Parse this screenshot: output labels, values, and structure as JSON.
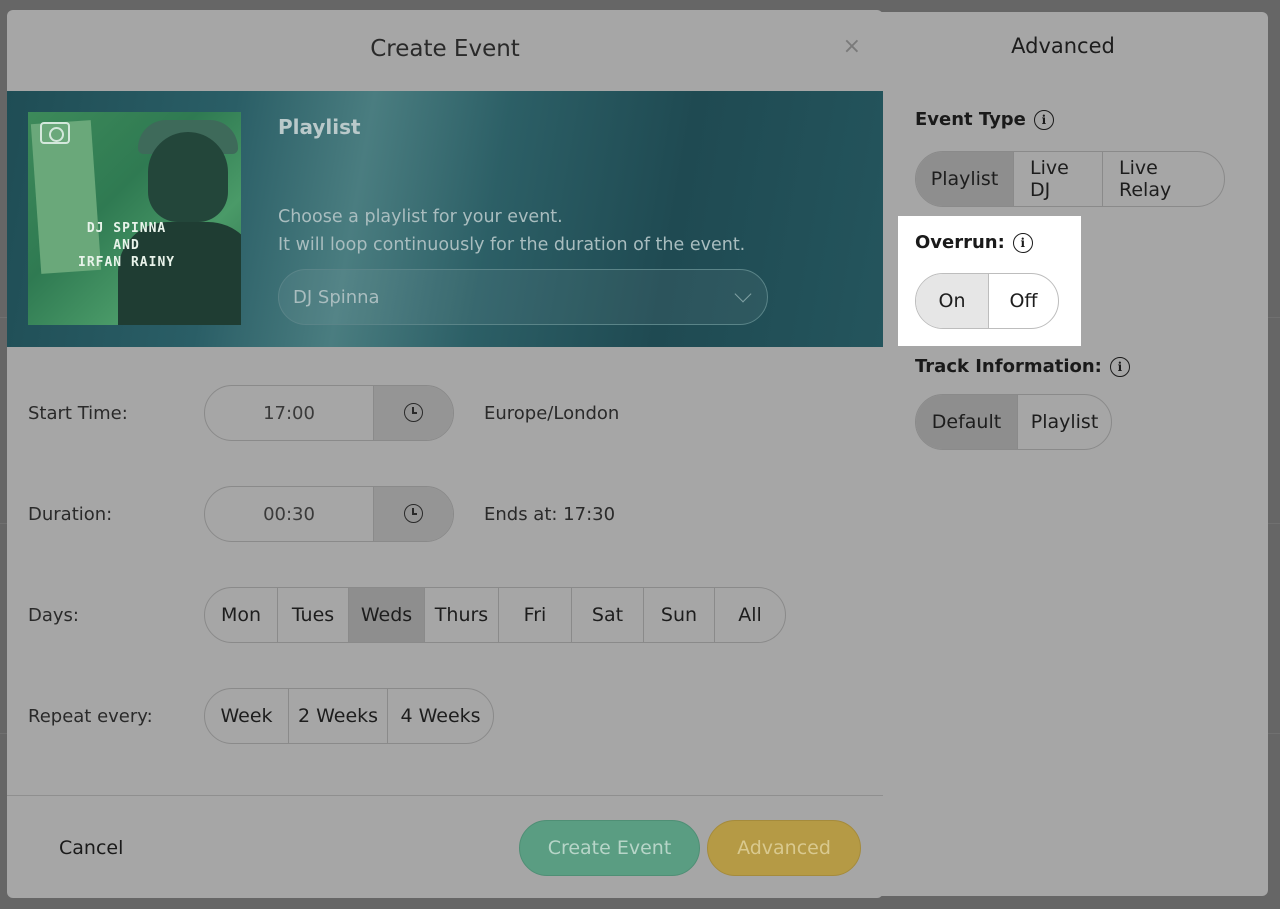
{
  "modal": {
    "title": "Create Event",
    "close_glyph": "×",
    "hero": {
      "label": "Playlist",
      "desc_line1": "Choose a playlist for your event.",
      "desc_line2": "It will loop continuously for the duration of the event.",
      "select_value": "DJ Spinna",
      "art_text_line1": "DJ SPINNA",
      "art_text_line2": "AND",
      "art_text_line3": "IRFAN RAINY"
    },
    "start_time": {
      "label": "Start Time:",
      "value": "17:00",
      "timezone": "Europe/London"
    },
    "duration": {
      "label": "Duration:",
      "value": "00:30",
      "ends_at": "Ends at: 17:30"
    },
    "days": {
      "label": "Days:",
      "options": [
        "Mon",
        "Tues",
        "Weds",
        "Thurs",
        "Fri",
        "Sat",
        "Sun",
        "All"
      ],
      "selected": "Weds"
    },
    "repeat": {
      "label": "Repeat every:",
      "options": [
        "Week",
        "2 Weeks",
        "4 Weeks"
      ]
    },
    "footer": {
      "cancel": "Cancel",
      "create": "Create Event",
      "advanced": "Advanced"
    }
  },
  "advanced": {
    "title": "Advanced",
    "event_type": {
      "label": "Event Type",
      "options": [
        "Playlist",
        "Live DJ",
        "Live Relay"
      ],
      "selected": "Playlist"
    },
    "overrun": {
      "label": "Overrun:",
      "options": [
        "On",
        "Off"
      ],
      "selected": "On"
    },
    "track_info": {
      "label": "Track Information:",
      "options": [
        "Default",
        "Playlist"
      ],
      "selected": "Default"
    }
  },
  "icons": {
    "info": "info-icon",
    "clock": "clock-icon",
    "camera": "camera-icon",
    "chevron": "chevron-down-icon",
    "close": "close-icon"
  },
  "colors": {
    "create_button": "#5a9d82",
    "advanced_button": "#b59a45",
    "hero_bg": "#2a5e66"
  }
}
